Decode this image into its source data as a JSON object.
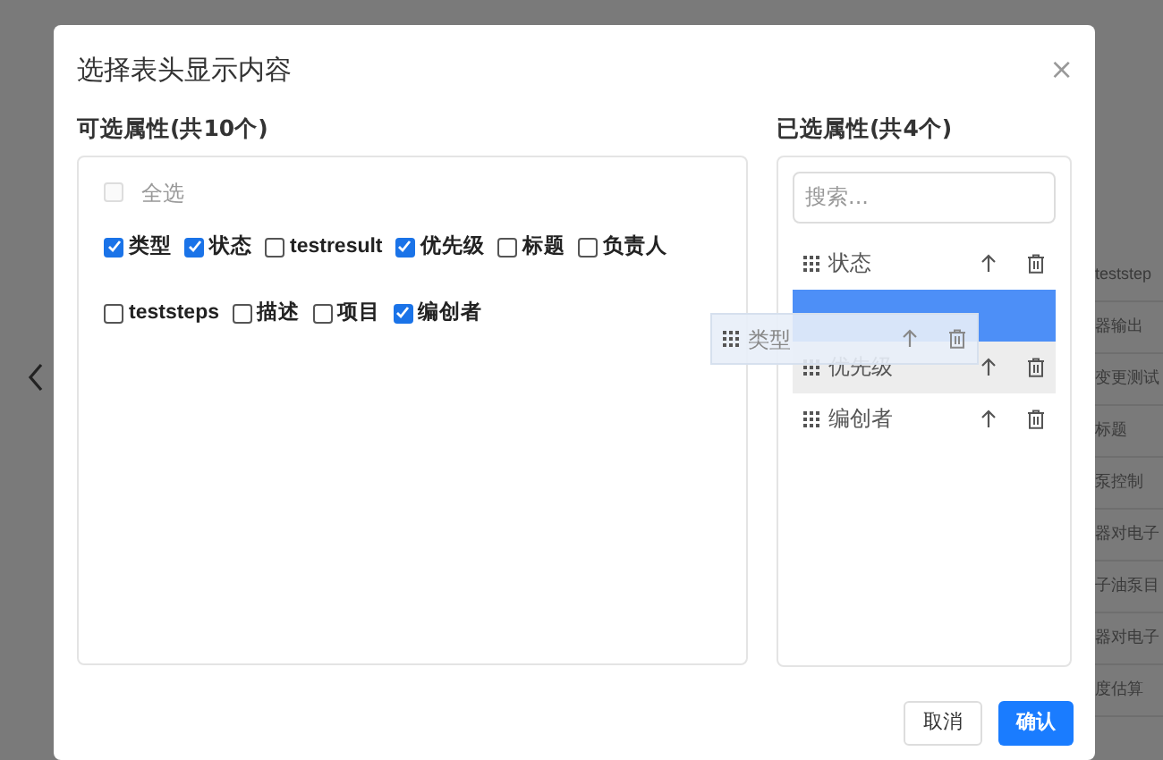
{
  "background": {
    "table_cells": [
      "teststep",
      "器输出",
      "变更测试",
      "标题",
      "泵控制",
      "器对电子",
      "子油泵目",
      "器对电子",
      "度估算"
    ]
  },
  "dialog": {
    "title": "选择表头显示内容",
    "close": "×",
    "available": {
      "heading": "可选属性(共10个)",
      "select_all": {
        "label": "全选",
        "checked": false,
        "disabled": true
      },
      "options": [
        {
          "label": "类型",
          "checked": true
        },
        {
          "label": "状态",
          "checked": true
        },
        {
          "label": "testresult",
          "checked": false
        },
        {
          "label": "优先级",
          "checked": true
        },
        {
          "label": "标题",
          "checked": false
        },
        {
          "label": "负责人",
          "checked": false
        },
        {
          "label": "teststeps",
          "checked": false
        },
        {
          "label": "描述",
          "checked": false
        },
        {
          "label": "项目",
          "checked": false
        },
        {
          "label": "编创者",
          "checked": true
        }
      ]
    },
    "chosen": {
      "heading": "已选属性(共4个)",
      "search": {
        "placeholder": "搜索..."
      },
      "items": [
        {
          "kind": "item",
          "label": "状态",
          "highlighted": false
        },
        {
          "kind": "drop_target"
        },
        {
          "kind": "item",
          "label": "优先级",
          "highlighted": true
        },
        {
          "kind": "item",
          "label": "编创者",
          "highlighted": false
        }
      ]
    },
    "dragging": {
      "label": "类型"
    },
    "buttons": [
      {
        "label": "取消",
        "primary": false
      },
      {
        "label": "确认",
        "primary": true
      }
    ]
  }
}
